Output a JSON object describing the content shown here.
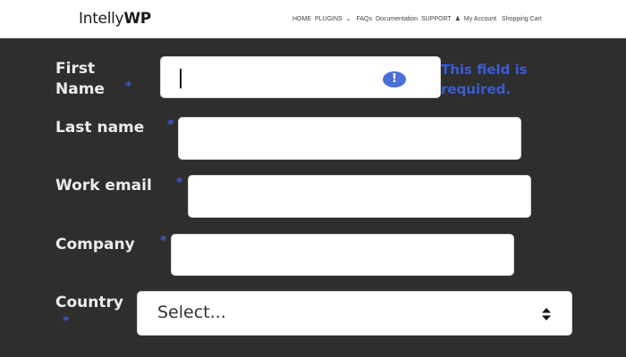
{
  "header": {
    "logo_light": "Intelly",
    "logo_bold": "WP",
    "nav": {
      "home": "HOME",
      "plugins": "PLUGINS",
      "plugins_chevron": "⌄",
      "faqs": "FAQs",
      "documentation": "Documentation",
      "support": "SUPPORT",
      "my_account": "My Account",
      "shopping_cart": "Shopping Cart"
    },
    "user_icon": "user-icon"
  },
  "form": {
    "required_marker": "*",
    "first_name": {
      "label_line1": "First",
      "label_line2": "Name",
      "value": "",
      "placeholder": "",
      "error_icon": "exclamation-icon",
      "error_symbol": "!",
      "error_line1": "This field is",
      "error_line2": "required."
    },
    "last_name": {
      "label": "Last name",
      "value": "",
      "placeholder": ""
    },
    "work_email": {
      "label": "Work email",
      "value": "",
      "placeholder": ""
    },
    "company": {
      "label": "Company",
      "value": "",
      "placeholder": ""
    },
    "country": {
      "label": "Country",
      "selected": "Select...",
      "arrow_icon": "updown-arrows-icon"
    }
  },
  "colors": {
    "background": "#2e2e2c",
    "required": "#3b5bd6",
    "error": "#3b5bd6",
    "label": "#ececec"
  }
}
